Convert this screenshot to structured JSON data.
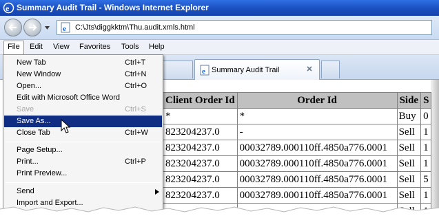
{
  "window": {
    "title": "Summary Audit Trail - Windows Internet Explorer"
  },
  "address": {
    "url": "C:\\Jts\\diggkktm\\Thu.audit.xmls.html"
  },
  "menubar": {
    "items": [
      "File",
      "Edit",
      "View",
      "Favorites",
      "Tools",
      "Help"
    ]
  },
  "tabs": {
    "active_label": "Summary Audit Trail"
  },
  "file_menu": {
    "items": [
      {
        "label": "New Tab",
        "shortcut": "Ctrl+T"
      },
      {
        "label": "New Window",
        "shortcut": "Ctrl+N"
      },
      {
        "label": "Open...",
        "shortcut": "Ctrl+O"
      },
      {
        "label": "Edit with Microsoft Office Word",
        "shortcut": ""
      },
      {
        "label": "Save",
        "shortcut": "Ctrl+S"
      },
      {
        "label": "Save As...",
        "shortcut": ""
      },
      {
        "label": "Close Tab",
        "shortcut": "Ctrl+W"
      },
      {
        "label": "Page Setup...",
        "shortcut": ""
      },
      {
        "label": "Print...",
        "shortcut": "Ctrl+P"
      },
      {
        "label": "Print Preview...",
        "shortcut": ""
      },
      {
        "label": "Send",
        "shortcut": ""
      },
      {
        "label": "Import and Export...",
        "shortcut": ""
      }
    ],
    "highlighted": "Save As...",
    "disabled": [
      "Save"
    ]
  },
  "table": {
    "headers": [
      "Client Order Id",
      "Order Id",
      "Side",
      "S"
    ],
    "rows": [
      [
        "*",
        "*",
        "Buy",
        "0"
      ],
      [
        "823204237.0",
        "-",
        "Sell",
        "1"
      ],
      [
        "823204237.0",
        "00032789.000110ff.4850a776.0001",
        "Sell",
        "1"
      ],
      [
        "823204237.0",
        "00032789.000110ff.4850a776.0001",
        "Sell",
        "1"
      ],
      [
        "823204237.0",
        "00032789.000110ff.4850a776.0001",
        "Sell",
        "5"
      ],
      [
        "823204237.0",
        "00032789.000110ff.4850a776.0001",
        "Sell",
        "1"
      ],
      [
        "",
        "",
        "Sell",
        "1"
      ]
    ]
  },
  "colors": {
    "titlebar": "#1a4fbf",
    "menu_highlight": "#0f2d82",
    "table_header": "#c0c0c0"
  }
}
